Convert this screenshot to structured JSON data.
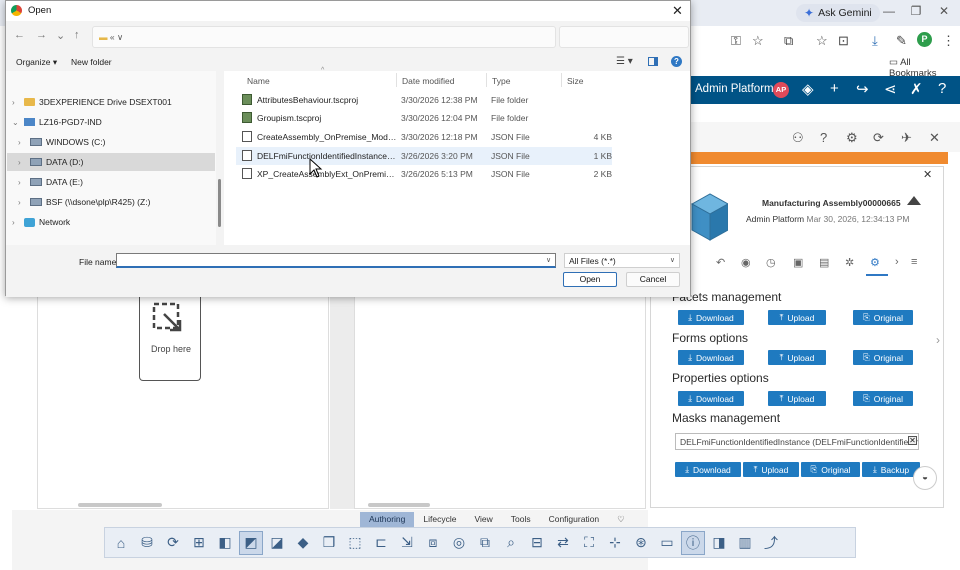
{
  "browser": {
    "gemini_label": "Ask Gemini",
    "profile_initial": "P",
    "all_bookmarks": "All Bookmarks"
  },
  "app": {
    "title": "Admin Platform",
    "user_badge": "AP",
    "panel": {
      "object_title": "Manufacturing Assembly00000665",
      "owner": "Admin Platform",
      "date": "Mar 30, 2026, 12:34:13 PM",
      "sections": [
        {
          "title": "Facets management"
        },
        {
          "title": "Forms options"
        },
        {
          "title": "Properties options"
        },
        {
          "title": "Masks management"
        }
      ],
      "btn_download": "Download",
      "btn_upload": "Upload",
      "btn_original": "Original",
      "btn_backup": "Backup",
      "mask_value": "DELFmiFunctionIdentifiedInstance (DELFmiFunctionIdentifiedInstan"
    },
    "drop_here": "Drop here",
    "command_tabs": [
      "Authoring",
      "Lifecycle",
      "View",
      "Tools",
      "Configuration"
    ],
    "active_tab": "Authoring"
  },
  "dialog": {
    "title": "Open",
    "address": "« ∨",
    "organize": "Organize ▾",
    "new_folder": "New folder",
    "columns": {
      "name": "Name",
      "date": "Date modified",
      "type": "Type",
      "size": "Size"
    },
    "nav_items": [
      {
        "label": "3DEXPERIENCE Drive DSEXT001",
        "chev": "›",
        "icon": "folder"
      },
      {
        "label": "LZ16-PGD7-IND",
        "chev": "⌄",
        "icon": "pc"
      },
      {
        "label": "WINDOWS (C:)",
        "chev": "›",
        "icon": "drive"
      },
      {
        "label": "DATA (D:)",
        "chev": "›",
        "icon": "drive"
      },
      {
        "label": "DATA (E:)",
        "chev": "›",
        "icon": "drive"
      },
      {
        "label": "BSF (\\\\dsone\\plp\\R425) (Z:)",
        "chev": "›",
        "icon": "drive"
      },
      {
        "label": "Network",
        "chev": "›",
        "icon": "network"
      }
    ],
    "files": [
      {
        "name": "AttributesBehaviour.tscproj",
        "date": "3/30/2026 12:38 PM",
        "type": "File folder",
        "size": "",
        "icon": "proj"
      },
      {
        "name": "Groupism.tscproj",
        "date": "3/30/2026 12:04 PM",
        "type": "File folder",
        "size": "",
        "icon": "proj"
      },
      {
        "name": "CreateAssembly_OnPremise_Modificatio...",
        "date": "3/30/2026 12:18 PM",
        "type": "JSON File",
        "size": "4 KB",
        "icon": "json"
      },
      {
        "name": "DELFmiFunctionIdentifiedInstance_OnPre...",
        "date": "3/26/2026 3:20 PM",
        "type": "JSON File",
        "size": "1 KB",
        "icon": "json"
      },
      {
        "name": "XP_CreateAssemblyExt_OnPremise_Modi...",
        "date": "3/26/2026 5:13 PM",
        "type": "JSON File",
        "size": "2 KB",
        "icon": "json"
      }
    ],
    "file_name_label": "File name:",
    "file_name_value": "",
    "filter": "All Files (*.*)",
    "open_button": "Open",
    "cancel_button": "Cancel"
  }
}
